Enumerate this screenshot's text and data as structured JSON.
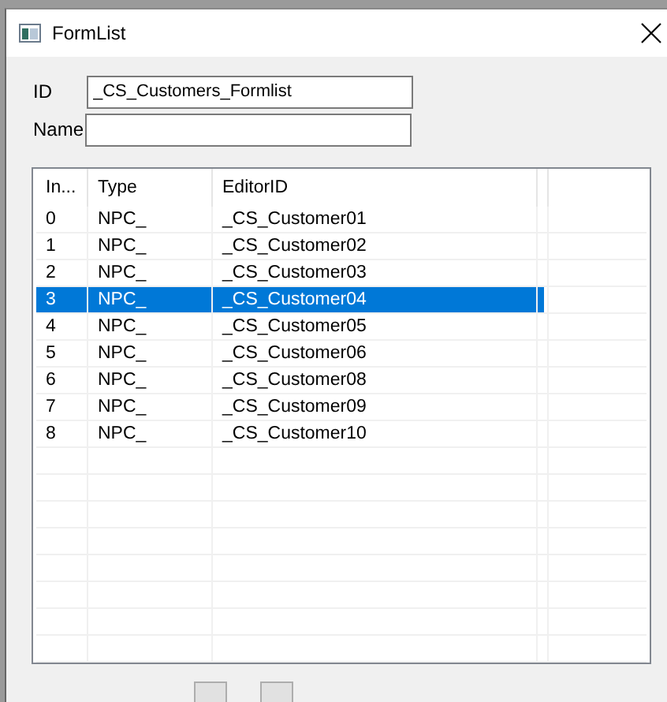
{
  "window": {
    "title": "FormList"
  },
  "fields": [
    {
      "label": "ID",
      "value": "_CS_Customers_Formlist"
    },
    {
      "label": "Name"
    }
  ],
  "table": {
    "columns": [
      "In...",
      "Type",
      "EditorID"
    ],
    "rows": [
      {
        "cells": [
          "0",
          "NPC_",
          "_CS_Customer01"
        ],
        "selected": false
      },
      {
        "cells": [
          "1",
          "NPC_",
          "_CS_Customer02"
        ],
        "selected": false
      },
      {
        "cells": [
          "2",
          "NPC_",
          "_CS_Customer03"
        ],
        "selected": false
      },
      {
        "cells": [
          "3",
          "NPC_",
          "_CS_Customer04"
        ],
        "selected": true
      },
      {
        "cells": [
          "4",
          "NPC_",
          "_CS_Customer05"
        ],
        "selected": false
      },
      {
        "cells": [
          "5",
          "NPC_",
          "_CS_Customer06"
        ],
        "selected": false
      },
      {
        "cells": [
          "6",
          "NPC_",
          "_CS_Customer08"
        ],
        "selected": false
      },
      {
        "cells": [
          "7",
          "NPC_",
          "_CS_Customer09"
        ],
        "selected": false
      },
      {
        "cells": [
          "8",
          "NPC_",
          "_CS_Customer10"
        ],
        "selected": false
      }
    ]
  }
}
